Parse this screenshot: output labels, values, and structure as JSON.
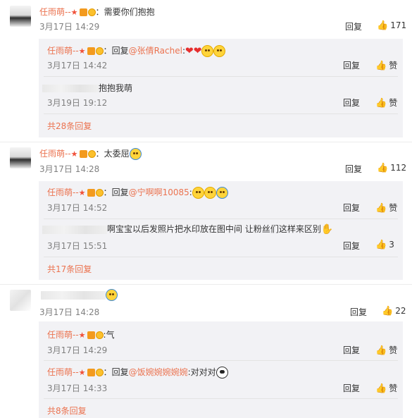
{
  "comments": [
    {
      "user": "任雨萌--",
      "text": "需要你们抱抱",
      "time": "3月17日 14:29",
      "reply_label": "回复",
      "likes": "171",
      "replies": [
        {
          "user": "任雨萌--",
          "prefix": "回复",
          "mention": "@张倩Rachel",
          "text": ":",
          "time": "3月17日 14:42",
          "reply_label": "回复",
          "like_label": "赞"
        },
        {
          "user": "",
          "prefix": "",
          "mention": "",
          "text": "抱抱我萌",
          "time": "3月19日 19:12",
          "reply_label": "回复",
          "like_label": "赞"
        }
      ],
      "more": "共28条回复"
    },
    {
      "user": "任雨萌--",
      "text": "太委屈",
      "time": "3月17日 14:28",
      "reply_label": "回复",
      "likes": "112",
      "replies": [
        {
          "user": "任雨萌--",
          "prefix": "回复",
          "mention": "@宁啊啊10085",
          "text": ":",
          "time": "3月17日 14:52",
          "reply_label": "回复",
          "like_label": "赞"
        },
        {
          "user": "",
          "prefix": "",
          "mention": "",
          "text": "啊宝宝以后发照片把水印放在图中间 让粉丝们这样来区别",
          "time": "3月17日 15:51",
          "reply_label": "回复",
          "like_label": "3"
        }
      ],
      "more": "共17条回复"
    },
    {
      "user": "",
      "text": "",
      "time": "3月17日 14:28",
      "reply_label": "回复",
      "likes": "22",
      "replies": [
        {
          "user": "任雨萌--",
          "prefix": "",
          "mention": "",
          "text": ":气",
          "time": "3月17日 14:29",
          "reply_label": "回复",
          "like_label": "赞"
        },
        {
          "user": "任雨萌--",
          "prefix": "回复",
          "mention": "@饭婉婉婉婉婉",
          "text": ":对对对",
          "time": "3月17日 14:33",
          "reply_label": "回复",
          "like_label": "赞"
        }
      ],
      "more": "共8条回复"
    }
  ],
  "icons": {
    "like": "thumbs-up-icon",
    "star": "star-badge-icon",
    "vip": "vip-badge-icon",
    "emoji": "emoji-icon",
    "heart": "heart-icon"
  },
  "colors": {
    "username": "#eb7350",
    "time": "#808080",
    "reply_box": "#f2f2f5"
  }
}
